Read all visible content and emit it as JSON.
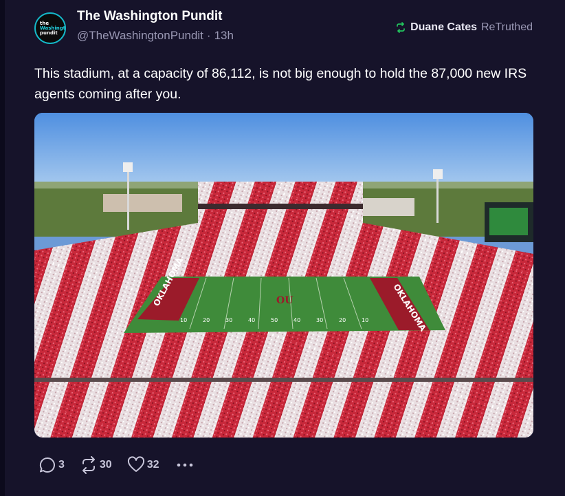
{
  "post": {
    "author": "The Washington Pundit",
    "handle": "@TheWashingtonPundit",
    "separator": "·",
    "time": "13h",
    "avatar": {
      "line1": "the",
      "line2": "Washington",
      "line3": "pundit"
    },
    "retruth": {
      "user": "Duane Cates",
      "label": "ReTruthed"
    },
    "text": "This stadium, at a capacity of 86,112, is not big enough to hold the 87,000 new IRS agents coming after you.",
    "media": {
      "end_zone_left": "OKLAHOMA",
      "end_zone_right": "OKLAHOMA",
      "yard_numbers": [
        "10",
        "20",
        "30",
        "40",
        "50",
        "40",
        "30",
        "20",
        "10"
      ],
      "midfield_logo": "OU"
    }
  },
  "actions": {
    "replies": "3",
    "retruths": "30",
    "likes": "32"
  },
  "colors": {
    "background": "#16132a",
    "accent_teal": "#14b8c8",
    "retruth_green": "#22c55e",
    "muted": "#9a98b4"
  }
}
